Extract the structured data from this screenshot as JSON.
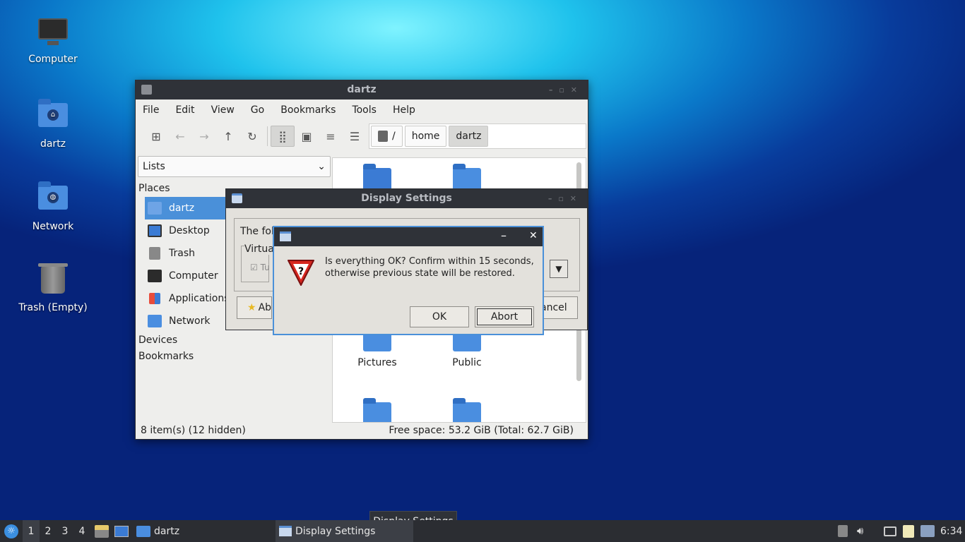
{
  "desktop": {
    "icons": [
      {
        "label": "Computer"
      },
      {
        "label": "dartz"
      },
      {
        "label": "Network"
      },
      {
        "label": "Trash (Empty)"
      }
    ]
  },
  "file_manager": {
    "title": "dartz",
    "menu": [
      "File",
      "Edit",
      "View",
      "Go",
      "Bookmarks",
      "Tools",
      "Help"
    ],
    "path": {
      "root": "/",
      "segments": [
        "home",
        "dartz"
      ]
    },
    "side_pane_mode": "Lists",
    "places_header": "Places",
    "places": [
      "dartz",
      "Desktop",
      "Trash",
      "Computer",
      "Applications",
      "Network"
    ],
    "devices_header": "Devices",
    "bookmarks_header": "Bookmarks",
    "files": [
      "Pictures",
      "Public"
    ],
    "status_left": "8 item(s) (12 hidden)",
    "status_right": "Free space: 53.2 GiB (Total: 62.7 GiB)"
  },
  "display_settings": {
    "title": "Display Settings",
    "text_partial": "The fol",
    "group_label_partial": "Virtua",
    "check_partial": "Tu",
    "about_partial": "Ab",
    "cancel_partial": "ancel"
  },
  "confirm_dialog": {
    "message_line1": "Is everything OK? Confirm within 15 seconds,",
    "message_line2": "otherwise previous state will be restored.",
    "ok_label": "OK",
    "abort_label": "Abort",
    "minimize_glyph": "–",
    "close_glyph": "✕"
  },
  "taskbar": {
    "workspaces": [
      "1",
      "2",
      "3",
      "4"
    ],
    "active_workspace": "1",
    "tasks": [
      {
        "label": "dartz"
      },
      {
        "label": "Display Settings"
      }
    ],
    "tooltip": "Display Settings",
    "clock": "6:34"
  },
  "colors": {
    "accent": "#4a90d9",
    "titlebar": "#2f3238",
    "taskbar": "#2b2d32"
  }
}
